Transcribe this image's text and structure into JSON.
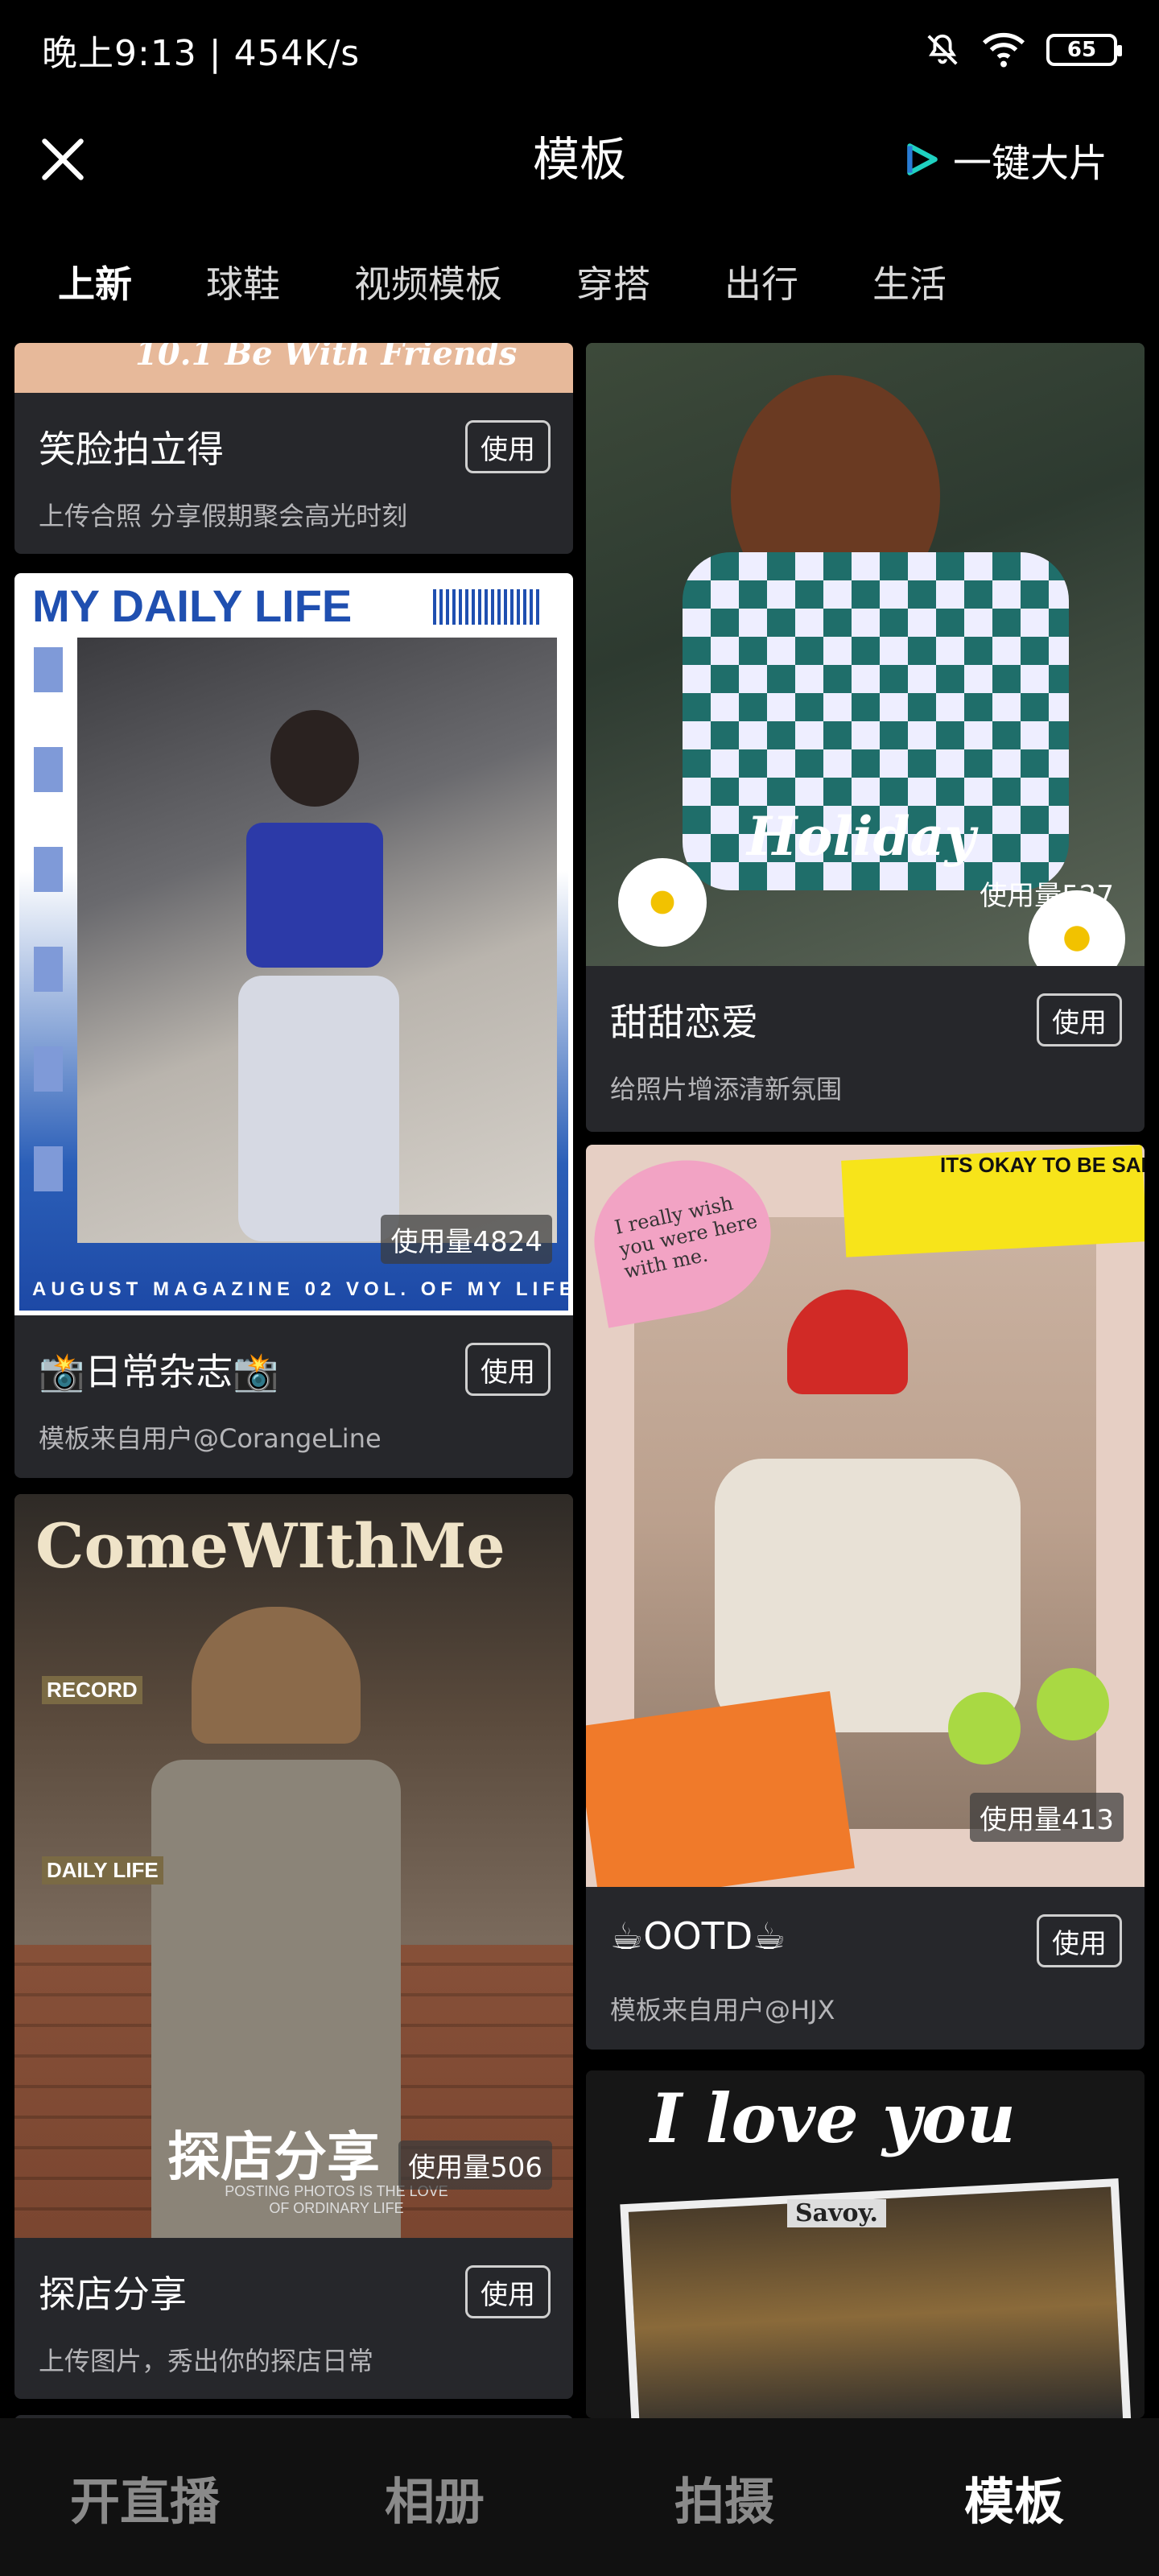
{
  "status_bar": {
    "time_speed": "晚上9:13 | 454K/s",
    "battery": "65"
  },
  "header": {
    "title": "模板",
    "right_action": "一键大片"
  },
  "tabs": [
    "上新",
    "球鞋",
    "视频模板",
    "穿搭",
    "出行",
    "生活"
  ],
  "left_column": [
    {
      "image_text": "10.1 Be With Friends",
      "title": "笑脸拍立得",
      "use_label": "使用",
      "description": "上传合照 分享假期聚会高光时刻"
    },
    {
      "image_header": "MY DAILY LIFE",
      "image_footer": "AUGUST MAGAZINE 02 VOL. OF MY LIFE",
      "usage": "使用量4824",
      "title": "📸日常杂志📸",
      "use_label": "使用",
      "description": "模板来自用户@CorangeLine"
    },
    {
      "image_header": "ComeWIthMe",
      "image_tags": [
        "RECORD",
        "DAILY LIFE"
      ],
      "image_caption": "探店分享",
      "image_subcaption": "POSTING PHOTOS IS THE LOVE OF ORDINARY LIFE",
      "usage": "使用量506",
      "title": "探店分享",
      "use_label": "使用",
      "description": "上传图片，秀出你的探店日常"
    }
  ],
  "right_column": [
    {
      "image_text": "Holiday",
      "usage": "使用量527",
      "title": "甜甜恋爱",
      "use_label": "使用",
      "description": "给照片增添清新氛围"
    },
    {
      "image_banner": "ITS OKAY TO BE SAD",
      "image_note": "I really wish you were here with me.",
      "usage": "使用量413",
      "title": "☕OOTD☕",
      "use_label": "使用",
      "description": "模板来自用户@HJX"
    },
    {
      "image_text": "I love you",
      "image_sign": "Savoy."
    }
  ],
  "bottom_nav": [
    "开直播",
    "相册",
    "拍摄",
    "模板"
  ],
  "colors": {
    "background": "#000000",
    "card": "#26272b",
    "accent": "#1fd1c1"
  }
}
